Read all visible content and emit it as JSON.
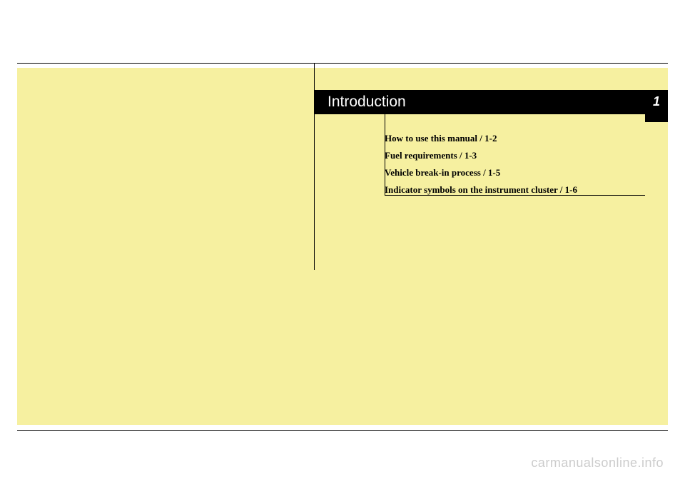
{
  "chapter": {
    "title": "Introduction",
    "number": "1"
  },
  "toc": {
    "items": [
      "How to use this manual / 1-2",
      "Fuel requirements / 1-3",
      "Vehicle break-in process / 1-5",
      "Indicator symbols on the instrument cluster / 1-6"
    ]
  },
  "watermark": "carmanualsonline.info"
}
